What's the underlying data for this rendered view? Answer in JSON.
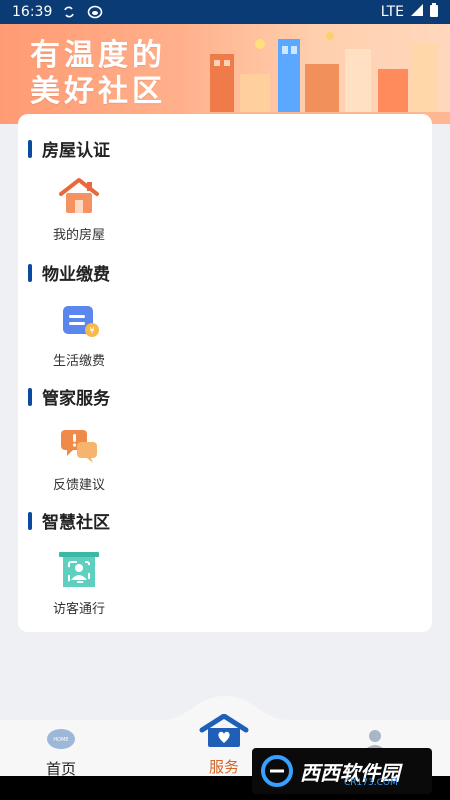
{
  "status_bar": {
    "time": "16:39",
    "network": "LTE"
  },
  "banner": {
    "slogan_line1": "有温度的",
    "slogan_line2": "美好社区"
  },
  "sections": [
    {
      "title": "房屋认证",
      "items": [
        {
          "label": "我的房屋",
          "icon": "house-icon"
        }
      ]
    },
    {
      "title": "物业缴费",
      "items": [
        {
          "label": "生活缴费",
          "icon": "bill-payment-icon"
        }
      ]
    },
    {
      "title": "管家服务",
      "items": [
        {
          "label": "反馈建议",
          "icon": "feedback-chat-icon"
        }
      ]
    },
    {
      "title": "智慧社区",
      "items": [
        {
          "label": "访客通行",
          "icon": "visitor-pass-icon"
        }
      ]
    }
  ],
  "nav": {
    "items": [
      {
        "label": "首页",
        "icon": "home-icon",
        "active": false
      },
      {
        "label": "服务",
        "icon": "service-house-icon",
        "active": true
      },
      {
        "label": "",
        "icon": "profile-icon",
        "active": false
      }
    ]
  },
  "watermark": {
    "text": "西西软件园",
    "sub": "CR173.COM"
  },
  "colors": {
    "status_bar": "#0b3b74",
    "accent_blue": "#0b4aa1",
    "active_orange": "#d4662b",
    "banner": "#ffa77f"
  }
}
